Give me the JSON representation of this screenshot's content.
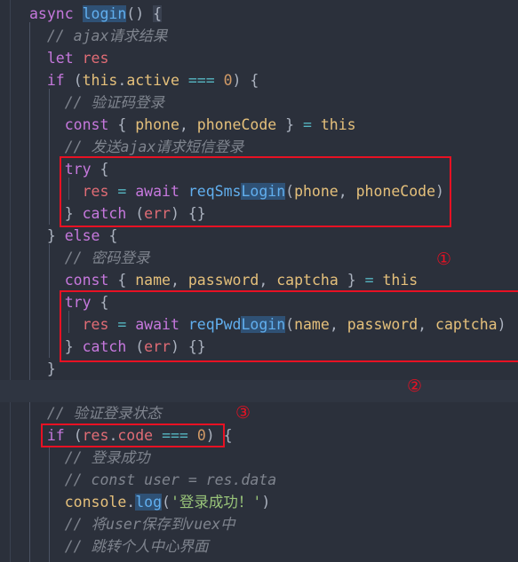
{
  "editor": {
    "language": "javascript",
    "theme": "One Dark",
    "background_color": "#2b303b",
    "line_height_px": 25,
    "font_size_px": 16.5
  },
  "code_lines": [
    {
      "n": 1,
      "text": "async login() {"
    },
    {
      "n": 2,
      "text": "  // ajax请求结果"
    },
    {
      "n": 3,
      "text": "  let res"
    },
    {
      "n": 4,
      "text": "  if (this.active === 0) {"
    },
    {
      "n": 5,
      "text": "    // 验证码登录"
    },
    {
      "n": 6,
      "text": "    const { phone, phoneCode } = this"
    },
    {
      "n": 7,
      "text": "    // 发送ajax请求短信登录"
    },
    {
      "n": 8,
      "text": "    try {"
    },
    {
      "n": 9,
      "text": "      res = await reqSmsLogin(phone, phoneCode)"
    },
    {
      "n": 10,
      "text": "    } catch (err) {}"
    },
    {
      "n": 11,
      "text": "  } else {"
    },
    {
      "n": 12,
      "text": "    // 密码登录"
    },
    {
      "n": 13,
      "text": "    const { name, password, captcha } = this"
    },
    {
      "n": 14,
      "text": "    try {"
    },
    {
      "n": 15,
      "text": "      res = await reqPwdLogin(name, password, captcha)"
    },
    {
      "n": 16,
      "text": "    } catch (err) {}"
    },
    {
      "n": 17,
      "text": "  }"
    },
    {
      "n": 18,
      "text": ""
    },
    {
      "n": 19,
      "text": "  // 验证登录状态"
    },
    {
      "n": 20,
      "text": "  if (res.code === 0) {"
    },
    {
      "n": 21,
      "text": "    // 登录成功"
    },
    {
      "n": 22,
      "text": "    // const user = res.data"
    },
    {
      "n": 23,
      "text": "    console.log('登录成功！')"
    },
    {
      "n": 24,
      "text": "    // 将user保存到vuex中"
    },
    {
      "n": 25,
      "text": "    // 跳转个人中心界面"
    }
  ],
  "tokens": {
    "l1": {
      "async": "async",
      "login": "login",
      "parens": "()",
      "brace": "{"
    },
    "l2": {
      "comment": "// ajax请求结果"
    },
    "l3": {
      "let": "let",
      "res": "res"
    },
    "l4": {
      "if": "if",
      "open": "(",
      "this": "this",
      "dot": ".",
      "active": "active",
      "eq": "===",
      "zero": "0",
      "close": ")",
      "brace": "{"
    },
    "l5": {
      "comment": "// 验证码登录"
    },
    "l6": {
      "const": "const",
      "open": "{",
      "phone": "phone",
      "comma": ",",
      "phoneCode": "phoneCode",
      "close": "}",
      "assign": "=",
      "this": "this"
    },
    "l7": {
      "comment": "// 发送ajax请求短信登录"
    },
    "l8": {
      "try": "try",
      "brace": "{"
    },
    "l9": {
      "res": "res",
      "assign": "=",
      "await": "await",
      "fn_prefix": "reqSms",
      "fn_sel": "Login",
      "open": "(",
      "a1": "phone",
      "comma": ",",
      "a2": "phoneCode",
      "close": ")"
    },
    "l10": {
      "closebrace": "}",
      "catch": "catch",
      "open": "(",
      "err": "err",
      "close": ")",
      "empty": "{}"
    },
    "l11": {
      "closebrace": "}",
      "else": "else",
      "brace": "{"
    },
    "l12": {
      "comment": "// 密码登录"
    },
    "l13": {
      "const": "const",
      "open": "{",
      "name": "name",
      "comma": ",",
      "password": "password",
      "captcha": "captcha",
      "close": "}",
      "assign": "=",
      "this": "this"
    },
    "l14": {
      "try": "try",
      "brace": "{"
    },
    "l15": {
      "res": "res",
      "assign": "=",
      "await": "await",
      "fn_prefix": "reqPwd",
      "fn_sel": "Login",
      "open": "(",
      "a1": "name",
      "a2": "password",
      "a3": "captcha",
      "close": ")"
    },
    "l16": {
      "closebrace": "}",
      "catch": "catch",
      "open": "(",
      "err": "err",
      "close": ")",
      "empty": "{}"
    },
    "l17": {
      "closebrace": "}"
    },
    "l19": {
      "comment": "// 验证登录状态"
    },
    "l20": {
      "if": "if",
      "open": "(",
      "res": "res",
      "dot": ".",
      "code": "code",
      "eq": "===",
      "zero": "0",
      "close": ")",
      "brace": "{"
    },
    "l21": {
      "comment": "// 登录成功"
    },
    "l22": {
      "comment": "// const user = res.data"
    },
    "l23": {
      "console": "console",
      "dot": ".",
      "log_sel": "log",
      "open": "(",
      "str": "'登录成功！'",
      "close": ")"
    },
    "l24": {
      "comment": "// 将user保存到vuex中"
    },
    "l25": {
      "comment": "// 跳转个人中心界面"
    }
  },
  "annotations": {
    "color": "#e81123",
    "boxes": [
      {
        "id": "box-try-sms",
        "label": "red-box-around-sms-try-catch"
      },
      {
        "id": "box-try-pwd",
        "label": "red-box-around-pwd-try-catch"
      },
      {
        "id": "box-if-code",
        "label": "red-box-around-if-res-code"
      }
    ],
    "markers": [
      {
        "id": "marker-1",
        "text": "①"
      },
      {
        "id": "marker-2",
        "text": "②"
      },
      {
        "id": "marker-3",
        "text": "③"
      }
    ]
  },
  "colors": {
    "background": "#2b303b",
    "highlight_line": "#2f3541",
    "keyword": "#c678dd",
    "function": "#61afef",
    "variable": "#e06c75",
    "property": "#e5c07b",
    "operator": "#56b6c2",
    "number": "#d19a66",
    "string": "#98c379",
    "comment": "#7f848e",
    "punctuation": "#abb2bf",
    "selection": "#2f5175",
    "annotation_red": "#e81123"
  }
}
